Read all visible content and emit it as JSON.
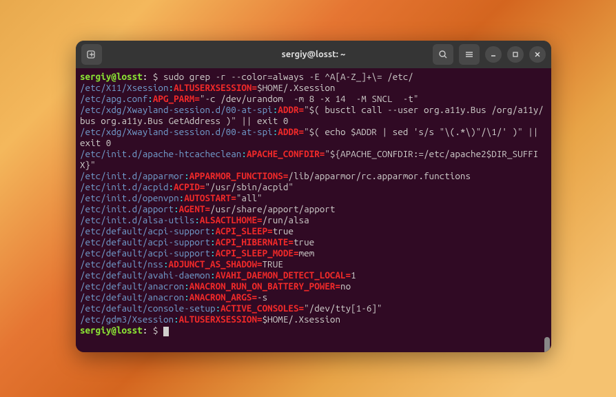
{
  "window": {
    "title": "sergiy@losst: ~"
  },
  "prompt": {
    "userhost": "sergiy@losst",
    "sep": ":",
    "cwd": "~",
    "marker": "$"
  },
  "command": "sudo grep -r --color=always -E ^A[A-Z_]+\\= /etc/",
  "lines": [
    {
      "path": "/etc/X11/Xsession",
      "var": "ALTUSERXSESSION=",
      "val": "$HOME/.Xsession"
    },
    {
      "path": "/etc/apg.conf",
      "var": "APG_PARM=",
      "val": "\"-c /dev/urandom  -m 8 -x 14  -M SNCL  -t\""
    },
    {
      "path": "/etc/xdg/Xwayland-session.d/00-at-spi",
      "var": "ADDR=",
      "val": "\"$( busctl call --user org.a11y.Bus /org/a11y/bus org.a11y.Bus GetAddress )\" || exit 0"
    },
    {
      "path": "/etc/xdg/Xwayland-session.d/00-at-spi",
      "var": "ADDR=",
      "val": "\"$( echo $ADDR | sed 's/s \"\\(.*\\)\"/\\1/' )\" || exit 0"
    },
    {
      "path": "/etc/init.d/apache-htcacheclean",
      "var": "APACHE_CONFDIR=",
      "val": "\"${APACHE_CONFDIR:=/etc/apache2$DIR_SUFFIX}\""
    },
    {
      "path": "/etc/init.d/apparmor",
      "var": "APPARMOR_FUNCTIONS=",
      "val": "/lib/apparmor/rc.apparmor.functions"
    },
    {
      "path": "/etc/init.d/acpid",
      "var": "ACPID=",
      "val": "\"/usr/sbin/acpid\""
    },
    {
      "path": "/etc/init.d/openvpn",
      "var": "AUTOSTART=",
      "val": "\"all\""
    },
    {
      "path": "/etc/init.d/apport",
      "var": "AGENT=",
      "val": "/usr/share/apport/apport"
    },
    {
      "path": "/etc/init.d/alsa-utils",
      "var": "ALSACTLHOME=",
      "val": "/run/alsa"
    },
    {
      "path": "/etc/default/acpi-support",
      "var": "ACPI_SLEEP=",
      "val": "true"
    },
    {
      "path": "/etc/default/acpi-support",
      "var": "ACPI_HIBERNATE=",
      "val": "true"
    },
    {
      "path": "/etc/default/acpi-support",
      "var": "ACPI_SLEEP_MODE=",
      "val": "mem"
    },
    {
      "path": "/etc/default/nss",
      "var": "ADJUNCT_AS_SHADOW=",
      "val": "TRUE"
    },
    {
      "path": "/etc/default/avahi-daemon",
      "var": "AVAHI_DAEMON_DETECT_LOCAL=",
      "val": "1"
    },
    {
      "path": "/etc/default/anacron",
      "var": "ANACRON_RUN_ON_BATTERY_POWER=",
      "val": "no"
    },
    {
      "path": "/etc/default/anacron",
      "var": "ANACRON_ARGS=",
      "val": "-s"
    },
    {
      "path": "/etc/default/console-setup",
      "var": "ACTIVE_CONSOLES=",
      "val": "\"/dev/tty[1-6]\""
    },
    {
      "path": "/etc/gdm3/Xsession",
      "var": "ALTUSERXSESSION=",
      "val": "$HOME/.Xsession"
    }
  ]
}
